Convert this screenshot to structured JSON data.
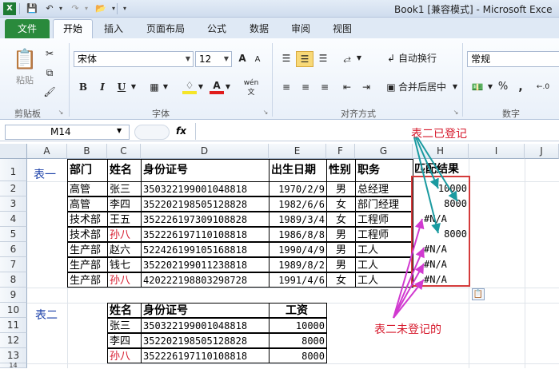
{
  "title": "Book1  [兼容模式]  -  Microsoft Exce",
  "quick_access": {
    "save": "save-icon",
    "undo": "undo-icon",
    "redo": "redo-icon",
    "open": "open-folder-icon"
  },
  "tabs": [
    "文件",
    "开始",
    "插入",
    "页面布局",
    "公式",
    "数据",
    "审阅",
    "视图"
  ],
  "ribbon": {
    "clipboard": {
      "paste": "粘贴",
      "label": "剪贴板"
    },
    "font": {
      "name": "宋体",
      "size": "12",
      "grow": "A",
      "shrink": "A",
      "bold": "B",
      "italic": "I",
      "underline": "U",
      "label": "字体",
      "wen": "wén"
    },
    "alignment": {
      "wrap": "自动换行",
      "merge": "合并后居中",
      "label": "对齐方式"
    },
    "number": {
      "format": "常规",
      "percent": "%",
      "comma": ",",
      "label": "数字"
    }
  },
  "formula": {
    "namebox": "M14",
    "fx": "fx",
    "content": ""
  },
  "columns": [
    "A",
    "B",
    "C",
    "D",
    "E",
    "F",
    "G",
    "H",
    "I",
    "J"
  ],
  "rows": [
    "1",
    "2",
    "3",
    "4",
    "5",
    "6",
    "7",
    "8",
    "9",
    "10",
    "11",
    "12",
    "13",
    "14"
  ],
  "table1": {
    "label": "表一",
    "headers": [
      "部门",
      "姓名",
      "身份证号",
      "出生日期",
      "性别",
      "职务",
      "匹配结果"
    ],
    "rows": [
      [
        "高管",
        "张三",
        "350322199001048818",
        "1970/2/9",
        "男",
        "总经理",
        "10000"
      ],
      [
        "高管",
        "李四",
        "352202198505128828",
        "1982/6/6",
        "女",
        "部门经理",
        "8000"
      ],
      [
        "技术部",
        "王五",
        "352226197309108828",
        "1989/3/4",
        "女",
        "工程师",
        "#N/A"
      ],
      [
        "技术部",
        "孙八",
        "352226197110108818",
        "1986/8/8",
        "男",
        "工程师",
        "8000"
      ],
      [
        "生产部",
        "赵六",
        "522426199105168818",
        "1990/4/9",
        "男",
        "工人",
        "#N/A"
      ],
      [
        "生产部",
        "钱七",
        "352202199011238818",
        "1989/8/2",
        "男",
        "工人",
        "#N/A"
      ],
      [
        "生产部",
        "孙八",
        "420222198803298728",
        "1991/4/6",
        "女",
        "工人",
        "#N/A"
      ]
    ]
  },
  "table2": {
    "label": "表二",
    "headers": [
      "姓名",
      "身份证号",
      "工资"
    ],
    "rows": [
      [
        "张三",
        "350322199001048818",
        "10000"
      ],
      [
        "李四",
        "352202198505128828",
        "8000"
      ],
      [
        "孙八",
        "352226197110108818",
        "8000"
      ]
    ]
  },
  "annotations": {
    "registered": "表二已登记",
    "not_registered": "表二未登记的"
  },
  "colors": {
    "accent_red": "#d6182b",
    "file_tab": "#2a8a3c",
    "arrow_teal": "#1a9aa0",
    "arrow_magenta": "#d13ad0"
  }
}
